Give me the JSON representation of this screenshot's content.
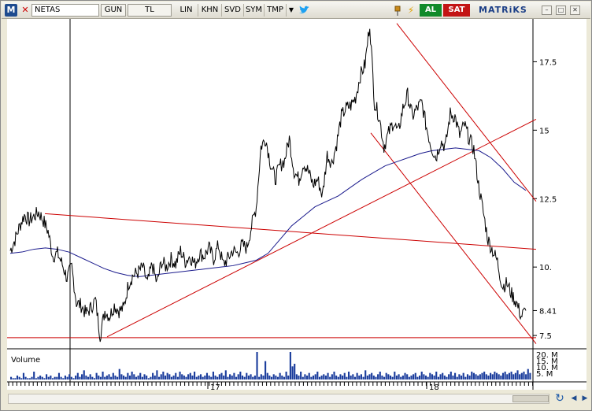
{
  "toolbar": {
    "logo": "M",
    "close": "✕",
    "ticker": "NETAS",
    "buttons": [
      "GUN",
      "TL",
      "LIN",
      "KHN",
      "SVD",
      "SYM",
      "TMP"
    ],
    "dropdown_icon": "▼",
    "twitter_icon": "twitter-bird",
    "pin_icon": "pin",
    "lightning_icon": "⚡",
    "buy_label": "AL",
    "sell_label": "SAT",
    "brand": "MATRiKS",
    "win_controls": [
      "–",
      "□",
      "✕"
    ],
    "colors": {
      "buy": "#118a2a",
      "sell": "#c31414",
      "brand": "#1b3e86"
    }
  },
  "chart_data": {
    "type": "line",
    "symbol": "NETAS",
    "y_ticks": [
      "17.5",
      "15",
      "12.5",
      "10.",
      "8.41",
      "7.5"
    ],
    "ylim": [
      7.1,
      18.95
    ],
    "last_price": "8.41",
    "x_ticks": [
      "17",
      "18"
    ],
    "volume_label": "Volume",
    "volume_ticks": [
      "20. M",
      "15. M",
      "10. M",
      "5. M"
    ],
    "price_series": [
      10.6,
      11.0,
      11.5,
      11.9,
      11.7,
      11.85,
      12.0,
      11.7,
      11.3,
      10.4,
      10.5,
      10.1,
      9.6,
      10.0,
      8.7,
      8.6,
      8.3,
      8.5,
      8.8,
      7.5,
      8.4,
      8.2,
      8.6,
      8.4,
      8.5,
      9.4,
      9.7,
      9.8,
      10.0,
      9.4,
      10.1,
      9.4,
      10.2,
      10.0,
      10.3,
      10.1,
      10.6,
      10.2,
      10.4,
      10.1,
      10.5,
      10.4,
      10.7,
      10.3,
      10.8,
      10.1,
      10.3,
      10.6,
      10.5,
      10.8,
      10.7,
      11.5,
      12.2,
      14.4,
      14.7,
      13.8,
      13.2,
      13.7,
      13.9,
      14.7,
      13.5,
      13.2,
      13.8,
      13.5,
      13.0,
      13.2,
      12.6,
      14.1,
      13.8,
      14.5,
      15.5,
      15.8,
      15.9,
      16.2,
      17.0,
      17.4,
      18.9,
      16.0,
      15.5,
      14.4,
      14.9,
      15.3,
      14.9,
      15.8,
      16.3,
      15.5,
      15.8,
      16.0,
      15.1,
      14.4,
      14.0,
      14.6,
      14.4,
      15.6,
      15.5,
      14.8,
      15.2,
      14.7,
      14.3,
      13.0,
      12.0,
      11.0,
      10.6,
      10.2,
      9.3,
      9.4,
      9.0,
      8.7,
      8.2,
      8.41
    ],
    "ma_series": [
      10.5,
      10.55,
      10.65,
      10.7,
      10.65,
      10.55,
      10.35,
      10.15,
      9.95,
      9.8,
      9.7,
      9.65,
      9.7,
      9.75,
      9.8,
      9.85,
      9.9,
      9.95,
      10.0,
      10.05,
      10.15,
      10.25,
      10.5,
      11.0,
      11.5,
      11.85,
      12.2,
      12.4,
      12.6,
      12.9,
      13.2,
      13.45,
      13.7,
      13.85,
      14.0,
      14.15,
      14.25,
      14.3,
      14.35,
      14.3,
      14.25,
      14.0,
      13.6,
      13.1,
      12.8
    ],
    "volume_bars": [
      2,
      1,
      1,
      3,
      2,
      1,
      5,
      2,
      1,
      1,
      2,
      6,
      1,
      2,
      3,
      2,
      1,
      4,
      2,
      3,
      1,
      2,
      2,
      5,
      2,
      1,
      3,
      2,
      4,
      2,
      1,
      3,
      5,
      2,
      4,
      7,
      3,
      2,
      4,
      2,
      1,
      5,
      3,
      2,
      6,
      2,
      3,
      4,
      2,
      5,
      3,
      2,
      8,
      4,
      3,
      2,
      5,
      3,
      6,
      4,
      2,
      3,
      5,
      2,
      4,
      3,
      1,
      2,
      5,
      3,
      7,
      2,
      4,
      6,
      3,
      5,
      4,
      2,
      3,
      5,
      2,
      6,
      4,
      3,
      2,
      4,
      5,
      3,
      6,
      2,
      3,
      4,
      2,
      3,
      5,
      3,
      2,
      6,
      3,
      2,
      4,
      5,
      3,
      7,
      2,
      4,
      3,
      5,
      2,
      4,
      6,
      3,
      2,
      5,
      3,
      4,
      2,
      3,
      21,
      2,
      4,
      3,
      14,
      5,
      3,
      2,
      4,
      3,
      2,
      5,
      3,
      2,
      6,
      3,
      21,
      10,
      12,
      4,
      3,
      6,
      2,
      4,
      3,
      5,
      2,
      3,
      4,
      6,
      2,
      3,
      4,
      3,
      5,
      2,
      4,
      6,
      3,
      2,
      4,
      3,
      5,
      2,
      6,
      3,
      4,
      2,
      5,
      3,
      4,
      2,
      7,
      3,
      4,
      5,
      3,
      2,
      4,
      6,
      3,
      2,
      5,
      4,
      3,
      2,
      6,
      3,
      4,
      2,
      3,
      5,
      4,
      2,
      3,
      4,
      5,
      2,
      3,
      6,
      4,
      3,
      2,
      5,
      4,
      3,
      6,
      2,
      4,
      5,
      3,
      2,
      4,
      6,
      3,
      5,
      2,
      4,
      3,
      5,
      2,
      4,
      3,
      6,
      5,
      4,
      3,
      4,
      5,
      6,
      4,
      3,
      5,
      4,
      6,
      5,
      4,
      3,
      5,
      6,
      4,
      5,
      6,
      4,
      5,
      7,
      4,
      5,
      6,
      4,
      8,
      5
    ],
    "colors": {
      "price": "#000000",
      "moving_average": "#1a1a8c",
      "trendlines": "#cc0000",
      "volume": "#1a3c9c",
      "grid_border": "#000000"
    },
    "grid": false
  },
  "bottom": {
    "nav_prev_icon": "◀",
    "nav_next_icon": "▶",
    "refresh_icon": "↻"
  }
}
